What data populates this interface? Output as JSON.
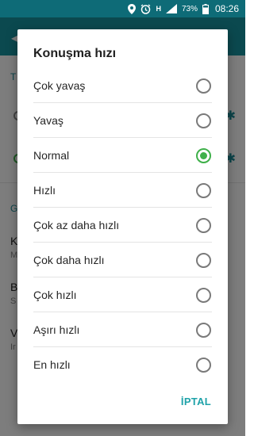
{
  "status_bar": {
    "battery_percent": "73%",
    "time": "08:26",
    "network": "H"
  },
  "background": {
    "section_t": "T",
    "section_g": "G",
    "items": [
      {
        "title": "K",
        "sub": "M"
      },
      {
        "title": "B",
        "sub": "S"
      },
      {
        "title": "V",
        "sub": "Ir"
      }
    ]
  },
  "dialog": {
    "title": "Konuşma hızı",
    "options": [
      {
        "label": "Çok yavaş",
        "selected": false
      },
      {
        "label": "Yavaş",
        "selected": false
      },
      {
        "label": "Normal",
        "selected": true
      },
      {
        "label": "Hızlı",
        "selected": false
      },
      {
        "label": "Çok az daha hızlı",
        "selected": false
      },
      {
        "label": "Çok daha hızlı",
        "selected": false
      },
      {
        "label": "Çok hızlı",
        "selected": false
      },
      {
        "label": "Aşırı hızlı",
        "selected": false
      },
      {
        "label": "En hızlı",
        "selected": false
      }
    ],
    "cancel_label": "İPTAL"
  },
  "colors": {
    "accent": "#1fa2a9",
    "selected_radio": "#3fb04a",
    "status_bar": "#0e6b77",
    "app_bar": "#16939f"
  }
}
